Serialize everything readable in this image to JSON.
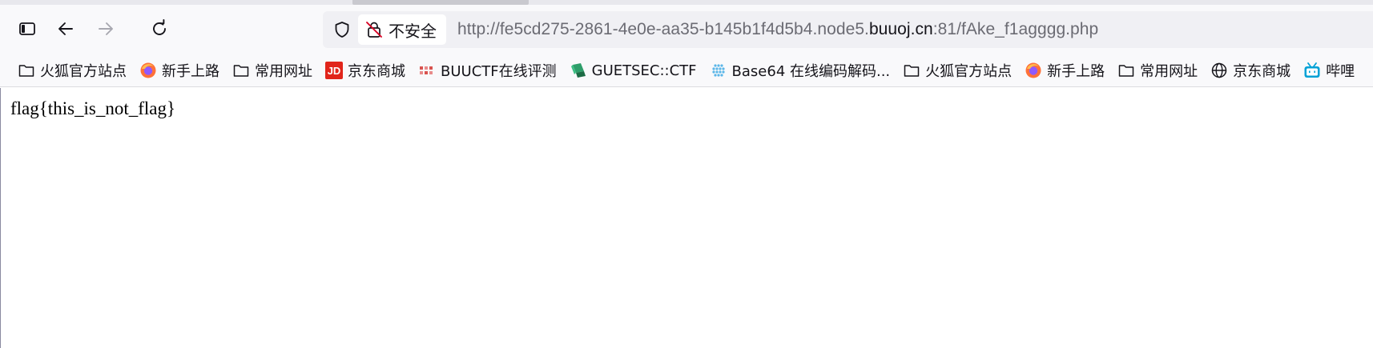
{
  "browser": {
    "security_label": "不安全",
    "url": {
      "prefix": "http://fe5cd275-2861-4e0e-aa35-b145b1f4d5b4.node5.",
      "domain": "buuoj.cn",
      "suffix": ":81/fAke_f1agggg.php"
    },
    "icons": {
      "sidebar": "sidebar-icon",
      "back": "back-arrow-icon",
      "forward": "forward-arrow-icon",
      "reload": "reload-icon",
      "shield": "shield-icon",
      "insecure": "insecure-lock-icon"
    }
  },
  "bookmarks": [
    {
      "label": "火狐官方站点",
      "icon": "folder-icon"
    },
    {
      "label": "新手上路",
      "icon": "firefox-icon"
    },
    {
      "label": "常用网址",
      "icon": "folder-icon"
    },
    {
      "label": "京东商城",
      "icon": "jd-icon"
    },
    {
      "label": "BUUCTF在线评测",
      "icon": "buuctf-icon"
    },
    {
      "label": "GUETSEC::CTF",
      "icon": "guetsec-icon"
    },
    {
      "label": "Base64 在线编码解码...",
      "icon": "base64-icon"
    },
    {
      "label": "火狐官方站点",
      "icon": "folder-icon"
    },
    {
      "label": "新手上路",
      "icon": "firefox-icon"
    },
    {
      "label": "常用网址",
      "icon": "folder-icon"
    },
    {
      "label": "京东商城",
      "icon": "globe-icon"
    },
    {
      "label": "哔哩",
      "icon": "bilibili-icon"
    }
  ],
  "page": {
    "text": "flag{this_is_not_flag}"
  },
  "colors": {
    "toolbar_bg": "#f9f9fb",
    "urlbar_bg": "#f0f0f4",
    "firefox_orange": "#ff7139",
    "jd_red": "#e1251b",
    "bilibili_blue": "#00a1d6"
  }
}
